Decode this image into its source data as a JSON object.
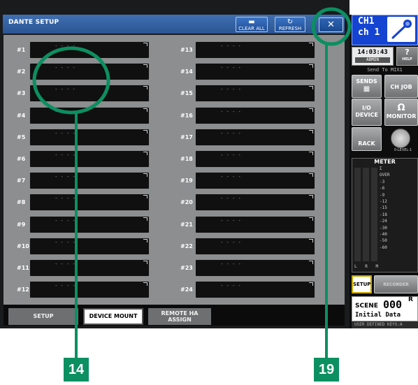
{
  "window": {
    "title": "DANTE SETUP",
    "toolbar": {
      "clear_all": "CLEAR ALL",
      "refresh": "REFRESH",
      "close": "✕"
    }
  },
  "slots": [
    {
      "no": "#1",
      "value": "- - - -"
    },
    {
      "no": "#2",
      "value": "- - - -"
    },
    {
      "no": "#3",
      "value": "- - - -"
    },
    {
      "no": "#4",
      "value": "- - - -"
    },
    {
      "no": "#5",
      "value": "- - - -"
    },
    {
      "no": "#6",
      "value": "- - - -"
    },
    {
      "no": "#7",
      "value": "- - - -"
    },
    {
      "no": "#8",
      "value": "- - - -"
    },
    {
      "no": "#9",
      "value": "- - - -"
    },
    {
      "no": "#10",
      "value": "- - - -"
    },
    {
      "no": "#11",
      "value": "- - - -"
    },
    {
      "no": "#12",
      "value": "- - - -"
    },
    {
      "no": "#13",
      "value": "- - - -"
    },
    {
      "no": "#14",
      "value": "- - - -"
    },
    {
      "no": "#15",
      "value": "- - - -"
    },
    {
      "no": "#16",
      "value": "- - - -"
    },
    {
      "no": "#17",
      "value": "- - - -"
    },
    {
      "no": "#18",
      "value": "- - - -"
    },
    {
      "no": "#19",
      "value": "- - - -"
    },
    {
      "no": "#20",
      "value": "- - - -"
    },
    {
      "no": "#21",
      "value": "- - - -"
    },
    {
      "no": "#22",
      "value": "- - - -"
    },
    {
      "no": "#23",
      "value": "- - - -"
    },
    {
      "no": "#24",
      "value": "- - - -"
    }
  ],
  "tabs": [
    {
      "label": "SETUP"
    },
    {
      "label": "DEVICE MOUNT",
      "selected": true
    },
    {
      "label_line1": "REMOTE HA",
      "label_line2": "ASSIGN"
    }
  ],
  "side": {
    "channel_line1": "CH1",
    "channel_line2": "ch 1",
    "time": "14:03:43",
    "user": "ADMIN",
    "help": "?",
    "help_sub": "HELP",
    "send_to": "Send To MIX1",
    "sends": "SENDS",
    "ch_job": "CH JOB",
    "io_device_1": "I/O",
    "io_device_2": "DEVICE",
    "monitor": "MONITOR",
    "rack": "RACK",
    "level_label": "0-LEVEL-1",
    "meter_title": "METER",
    "meter_scale": [
      "Σ",
      "OVER",
      "-3",
      "-6",
      "-9",
      "-12",
      "-15",
      "-18",
      "-24",
      "-30",
      "-40",
      "-50",
      "-60"
    ],
    "meter_lrm": "L R M",
    "setup": "SETUP",
    "recorder": "RECORDER",
    "scene_label": "SCENE",
    "scene_number": "000",
    "scene_flag": "R",
    "scene_name": "Initial Data",
    "user_keys": "USER DEFINED KEYS:A"
  },
  "callouts": {
    "left": "14",
    "right": "19"
  },
  "colors": {
    "title_bar": "#2f5f9f",
    "panel": "#8c8e8f",
    "callout": "#0c8f61",
    "channel_box": "#1444d1"
  }
}
